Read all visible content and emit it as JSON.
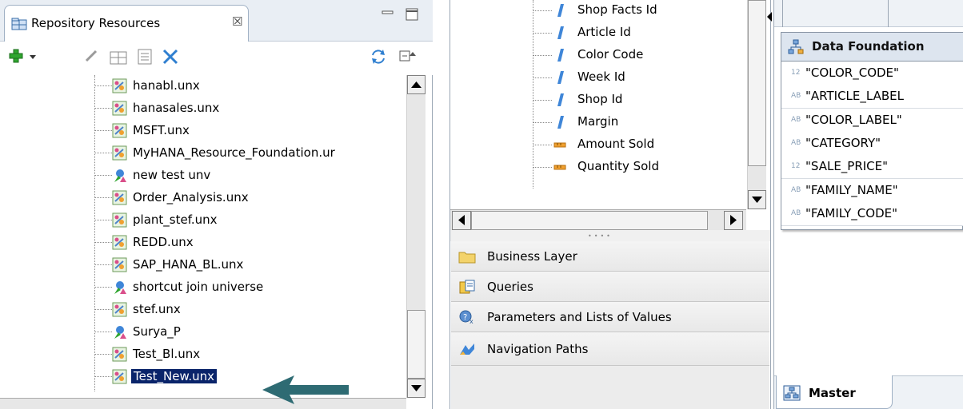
{
  "repository": {
    "tab_title": "Repository Resources",
    "close_glyph": "☒",
    "items": [
      {
        "label": "hanabl.unx",
        "icon": "universe-icon"
      },
      {
        "label": "hanasales.unx",
        "icon": "universe-icon"
      },
      {
        "label": "MSFT.unx",
        "icon": "universe-icon"
      },
      {
        "label": "MyHANA_Resource_Foundation.ur",
        "icon": "universe-icon"
      },
      {
        "label": "new test unv",
        "icon": "unv-icon"
      },
      {
        "label": "Order_Analysis.unx",
        "icon": "universe-icon"
      },
      {
        "label": "plant_stef.unx",
        "icon": "universe-icon"
      },
      {
        "label": "REDD.unx",
        "icon": "universe-icon"
      },
      {
        "label": "SAP_HANA_BL.unx",
        "icon": "universe-icon"
      },
      {
        "label": "shortcut join universe",
        "icon": "unv-icon"
      },
      {
        "label": "stef.unx",
        "icon": "universe-icon"
      },
      {
        "label": "Surya_P",
        "icon": "unv-icon"
      },
      {
        "label": "Test_Bl.unx",
        "icon": "universe-icon"
      },
      {
        "label": "Test_New.unx",
        "icon": "universe-icon",
        "selected": true
      }
    ]
  },
  "business_layer_tree": {
    "items": [
      {
        "label": "Shop Facts Id",
        "icon": "dimension-icon"
      },
      {
        "label": "Article Id",
        "icon": "dimension-icon"
      },
      {
        "label": "Color Code",
        "icon": "dimension-icon"
      },
      {
        "label": "Week Id",
        "icon": "dimension-icon"
      },
      {
        "label": "Shop Id",
        "icon": "dimension-icon"
      },
      {
        "label": "Margin",
        "icon": "dimension-icon"
      },
      {
        "label": "Amount Sold",
        "icon": "measure-icon"
      },
      {
        "label": "Quantity Sold",
        "icon": "measure-icon"
      }
    ]
  },
  "sections": [
    {
      "label": "Business Layer",
      "icon": "folder-icon"
    },
    {
      "label": "Queries",
      "icon": "queries-icon"
    },
    {
      "label": "Parameters and Lists of Values",
      "icon": "parameters-icon"
    },
    {
      "label": "Navigation Paths",
      "icon": "navigation-paths-icon"
    }
  ],
  "data_foundation": {
    "title": "Data Foundation",
    "columns": [
      {
        "type": "12",
        "name": "\"COLOR_CODE\""
      },
      {
        "type": "AB",
        "name": "\"ARTICLE_LABEL"
      },
      {
        "type": "AB",
        "name": "\"COLOR_LABEL\""
      },
      {
        "type": "AB",
        "name": "\"CATEGORY\""
      },
      {
        "type": "12",
        "name": "\"SALE_PRICE\""
      },
      {
        "type": "AB",
        "name": "\"FAMILY_NAME\""
      },
      {
        "type": "AB",
        "name": "\"FAMILY_CODE\""
      }
    ]
  },
  "master_tab": {
    "label": "Master"
  },
  "colors": {
    "selection": "#0a246a",
    "arrow": "#2e6b73",
    "add": "#2fa52f",
    "delete": "#2f7fd0"
  }
}
